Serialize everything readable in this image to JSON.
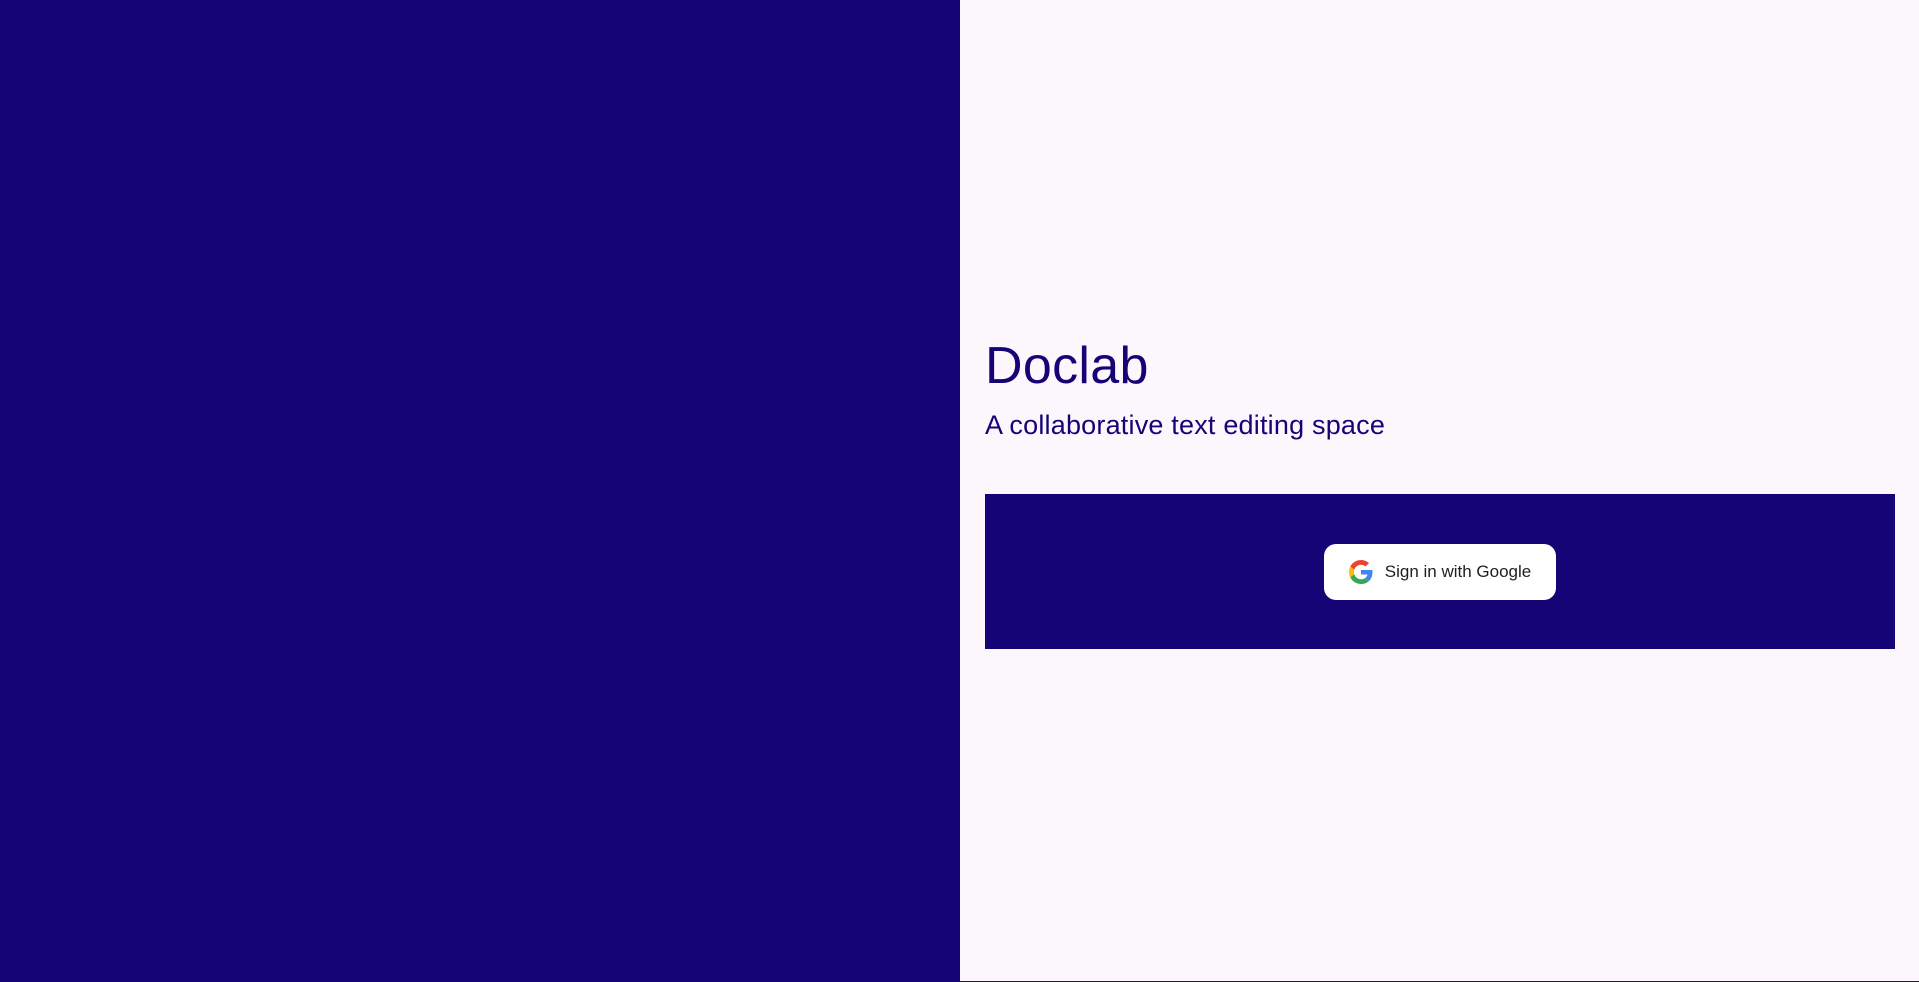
{
  "app": {
    "title": "Doclab",
    "subtitle": "A collaborative text editing space"
  },
  "signin": {
    "google_button_label": "Sign in with Google",
    "icon": "google-logo-icon"
  },
  "colors": {
    "primary": "#140476",
    "background": "#fcf7fd",
    "button_background": "#ffffff",
    "button_text": "#1f1f1f"
  }
}
